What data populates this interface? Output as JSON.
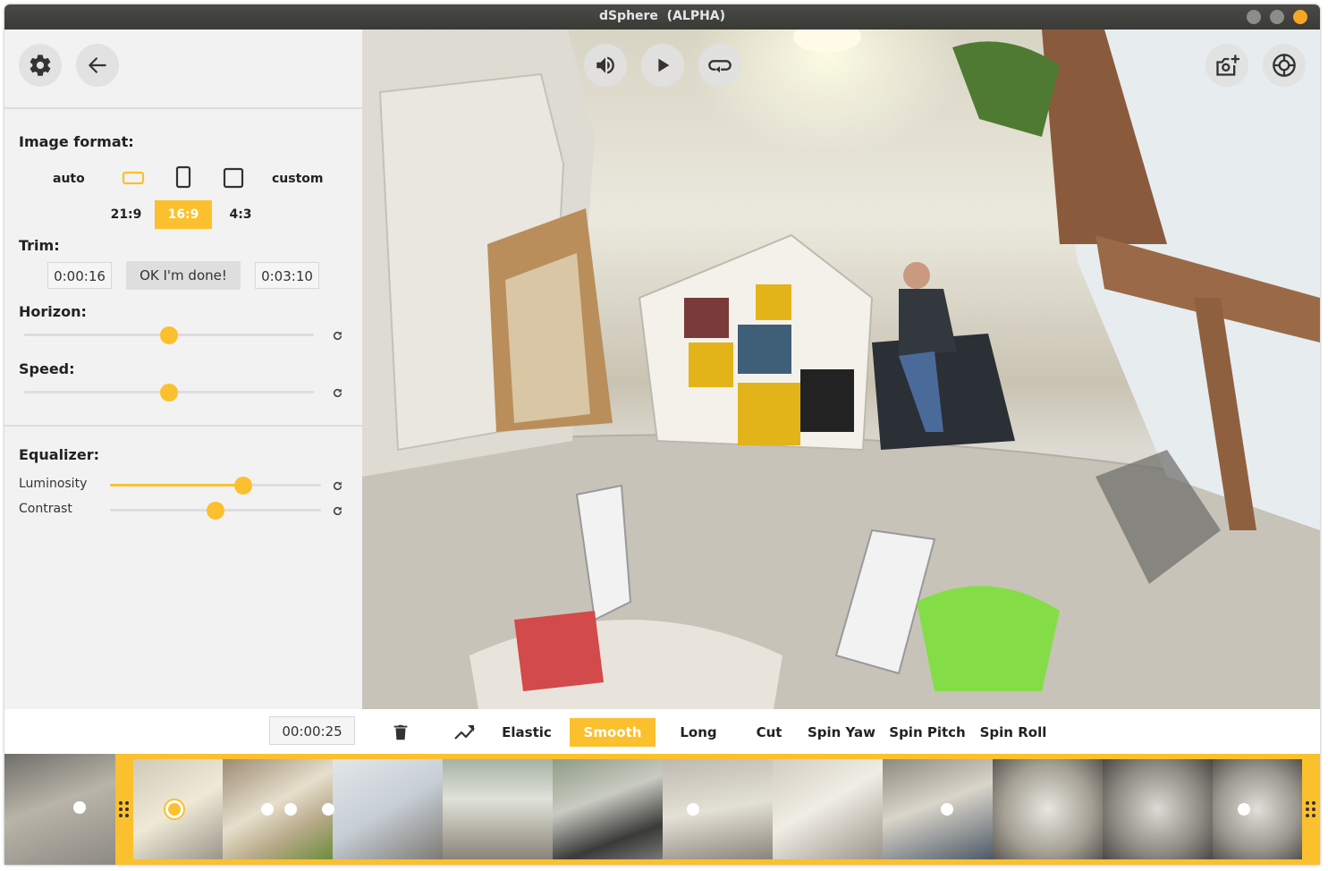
{
  "window": {
    "title": "dSphere  (ALPHA)"
  },
  "sidebar": {
    "settings_icon": "gear-icon",
    "back_icon": "arrow-left-icon",
    "image_format": {
      "label": "Image format:",
      "auto_label": "auto",
      "custom_label": "custom",
      "orientations": [
        "landscape-icon",
        "portrait-icon",
        "square-icon"
      ],
      "ratios": [
        "21:9",
        "16:9",
        "4:3"
      ],
      "selected_ratio": "16:9"
    },
    "trim": {
      "label": "Trim:",
      "start": "0:00:16",
      "done_label": "OK I'm done!",
      "end": "0:03:10"
    },
    "horizon": {
      "label": "Horizon:",
      "value": 0.5
    },
    "speed": {
      "label": "Speed:",
      "value": 0.5
    },
    "equalizer": {
      "label": "Equalizer:",
      "luminosity": {
        "label": "Luminosity",
        "value": 0.63
      },
      "contrast": {
        "label": "Contrast",
        "value": 0.5
      }
    }
  },
  "viewer": {
    "controls": [
      "volume-icon",
      "play-icon",
      "loop-icon"
    ],
    "right_controls": [
      "camera-add-icon",
      "settings-circle-icon"
    ]
  },
  "toolbar": {
    "time": "00:00:25",
    "delete_icon": "trash-icon",
    "curve_icon": "trend-icon",
    "modes": [
      "Elastic",
      "Smooth",
      "Long",
      "Cut",
      "Spin Yaw",
      "Spin Pitch",
      "Spin Roll"
    ],
    "selected_mode": "Smooth"
  },
  "colors": {
    "accent": "#fbc02d",
    "titlebar": "#3c3b37",
    "panel": "#f2f2f2"
  }
}
